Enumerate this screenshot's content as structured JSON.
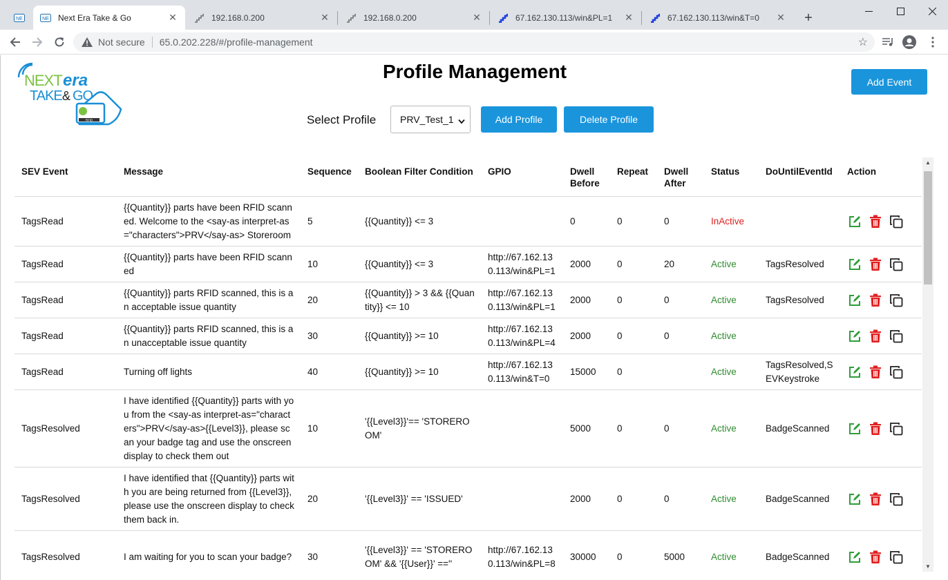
{
  "browser": {
    "tabs": [
      {
        "title": "",
        "favicon": "nextera-icon"
      },
      {
        "title": "Next Era Take & Go",
        "favicon": "nextera-icon",
        "active": true
      },
      {
        "title": "192.168.0.200",
        "favicon": "stairs-icon"
      },
      {
        "title": "192.168.0.200",
        "favicon": "stairs-icon"
      },
      {
        "title": "67.162.130.113/win&PL=1",
        "favicon": "blue-stairs-icon"
      },
      {
        "title": "67.162.130.113/win&T=0",
        "favicon": "blue-stairs-icon"
      }
    ],
    "new_tab": "+",
    "security_label": "Not secure",
    "url": "65.0.202.228/#/profile-management"
  },
  "header": {
    "logo": {
      "line1": "NEXTera",
      "line2": "TAKE&GO",
      "chip": "RFID"
    },
    "title": "Profile Management",
    "add_event_label": "Add Event"
  },
  "profile_bar": {
    "label": "Select Profile",
    "selected": "PRV_Test_1",
    "add_label": "Add Profile",
    "delete_label": "Delete Profile"
  },
  "table": {
    "headers": {
      "sev": "SEV Event",
      "message": "Message",
      "sequence": "Sequence",
      "filter": "Boolean Filter Condition",
      "gpio": "GPIO",
      "dwell_before": "Dwell Before",
      "repeat": "Repeat",
      "dwell_after": "Dwell After",
      "status": "Status",
      "do_until": "DoUntilEventId",
      "action": "Action"
    },
    "rows": [
      {
        "sev": "TagsRead",
        "message": "{{Quantity}} parts have been RFID scanned. Welcome to the <say-as interpret-as=\"characters\">PRV</say-as> Storeroom",
        "sequence": "5",
        "filter": "{{Quantity}} <= 3",
        "gpio": "",
        "dwell_before": "0",
        "repeat": "0",
        "dwell_after": "0",
        "status": "InActive",
        "do_until": ""
      },
      {
        "sev": "TagsRead",
        "message": "{{Quantity}} parts have been RFID scanned",
        "sequence": "10",
        "filter": "{{Quantity}} <= 3",
        "gpio": "http://67.162.130.113/win&PL=1",
        "dwell_before": "2000",
        "repeat": "0",
        "dwell_after": "20",
        "status": "Active",
        "do_until": "TagsResolved"
      },
      {
        "sev": "TagsRead",
        "message": "{{Quantity}} parts RFID scanned, this is an acceptable issue quantity",
        "sequence": "20",
        "filter": "{{Quantity}} > 3 && {{Quantity}} <= 10",
        "gpio": "http://67.162.130.113/win&PL=1",
        "dwell_before": "2000",
        "repeat": "0",
        "dwell_after": "0",
        "status": "Active",
        "do_until": "TagsResolved"
      },
      {
        "sev": "TagsRead",
        "message": "{{Quantity}} parts RFID scanned, this is an unacceptable issue quantity",
        "sequence": "30",
        "filter": "{{Quantity}} >= 10",
        "gpio": "http://67.162.130.113/win&PL=4",
        "dwell_before": "2000",
        "repeat": "0",
        "dwell_after": "0",
        "status": "Active",
        "do_until": ""
      },
      {
        "sev": "TagsRead",
        "message": "Turning off lights",
        "sequence": "40",
        "filter": "{{Quantity}} >= 10",
        "gpio": "http://67.162.130.113/win&T=0",
        "dwell_before": "15000",
        "repeat": "0",
        "dwell_after": "",
        "status": "Active",
        "do_until": "TagsResolved,SEVKeystroke"
      },
      {
        "sev": "TagsResolved",
        "message": "I have identified {{Quantity}} parts with you from the <say-as interpret-as=\"characters\">PRV</say-as>{{Level3}}, please scan your badge tag and use the onscreen display to check them out",
        "sequence": "10",
        "filter": "'{{Level3}}'== 'STOREROOM'",
        "gpio": "",
        "dwell_before": "5000",
        "repeat": "0",
        "dwell_after": "0",
        "status": "Active",
        "do_until": "BadgeScanned"
      },
      {
        "sev": "TagsResolved",
        "message": "I have identified that {{Quantity}} parts with you are being returned from {{Level3}}, please use the onscreen display to check them back in.",
        "sequence": "20",
        "filter": "'{{Level3}}' == 'ISSUED'",
        "gpio": "",
        "dwell_before": "2000",
        "repeat": "0",
        "dwell_after": "0",
        "status": "Active",
        "do_until": "BadgeScanned"
      },
      {
        "sev": "TagsResolved",
        "message": "I am waiting for you to scan your badge?",
        "sequence": "30",
        "filter": "'{{Level3}}' == 'STOREROOM' && '{{User}}' ==''",
        "gpio": "http://67.162.130.113/win&PL=8",
        "dwell_before": "30000",
        "repeat": "0",
        "dwell_after": "5000",
        "status": "Active",
        "do_until": "BadgeScanned"
      }
    ],
    "row_heights": [
      72,
      52,
      52,
      52,
      52,
      112,
      92,
      76
    ]
  },
  "colors": {
    "accent": "#1a95dc",
    "active": "#2e8b2e",
    "inactive": "#e02020",
    "edit_icon": "#2e9d3a",
    "delete_icon": "#e02020"
  }
}
